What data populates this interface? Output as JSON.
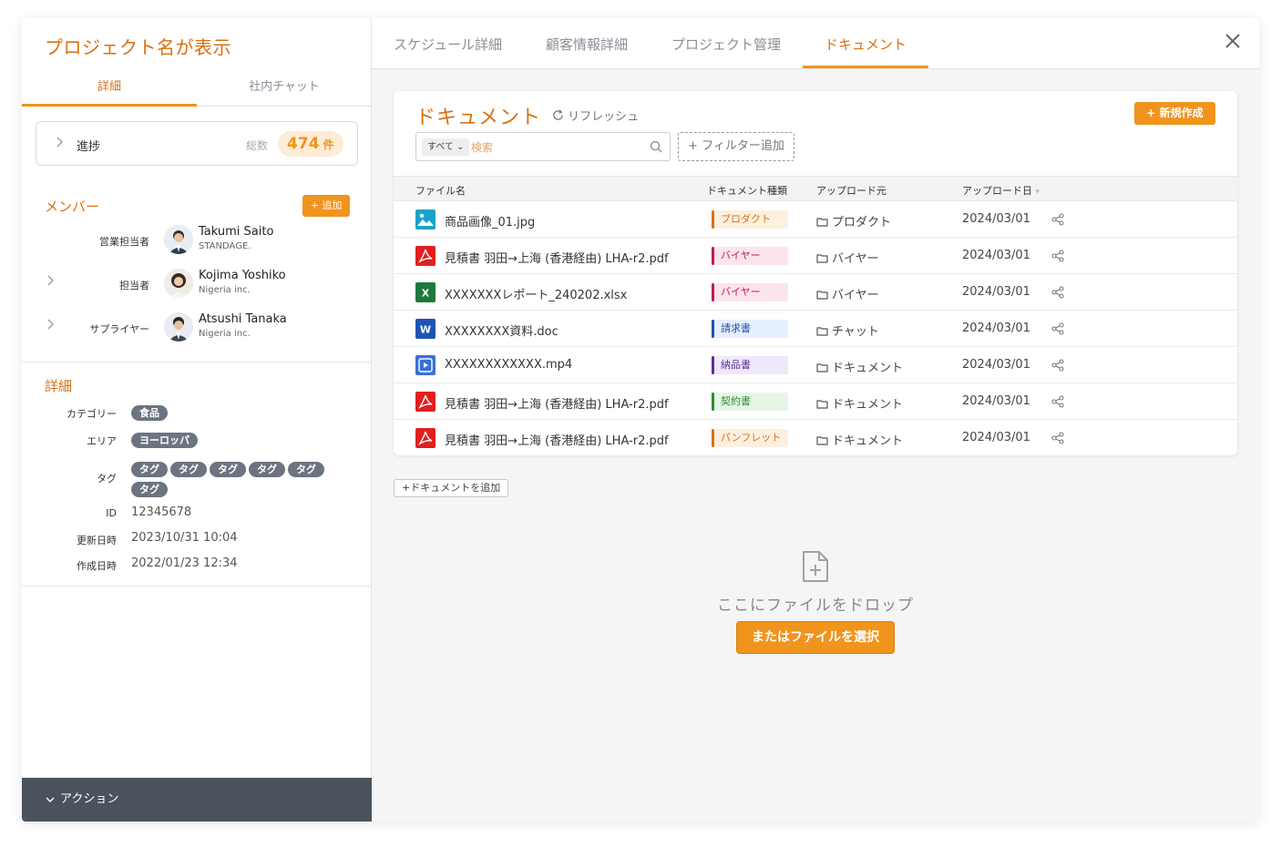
{
  "left": {
    "project_title": "プロジェクト名が表示",
    "tabs": [
      {
        "label": "詳細"
      },
      {
        "label": "社内チャット"
      }
    ],
    "progress": {
      "label": "進捗",
      "total_label": "総数",
      "count": "474",
      "unit": "件"
    },
    "members": {
      "title": "メンバー",
      "add_label": "+ 追加",
      "items": [
        {
          "role": "営業担当者",
          "name": "Takumi Saito",
          "org": "STANDAGE."
        },
        {
          "role": "担当者",
          "name": "Kojima Yoshiko",
          "org": "Nigeria inc."
        },
        {
          "role": "サプライヤー",
          "name": "Atsushi Tanaka",
          "org": "Nigeria inc."
        }
      ]
    },
    "details": {
      "title": "詳細",
      "category_label": "カテゴリー",
      "category": "食品",
      "area_label": "エリア",
      "area": "ヨーロッパ",
      "tag_label": "タグ",
      "tags": [
        "タグ",
        "タグ",
        "タグ",
        "タグ",
        "タグ",
        "タグ"
      ],
      "id_label": "ID",
      "id": "12345678",
      "updated_label": "更新日時",
      "updated": "2023/10/31 10:04",
      "created_label": "作成日時",
      "created": "2022/01/23 12:34"
    },
    "action_label": "アクション"
  },
  "right": {
    "tabs": [
      {
        "label": "スケジュール詳細"
      },
      {
        "label": "顧客情報詳細"
      },
      {
        "label": "プロジェクト管理"
      },
      {
        "label": "ドキュメント"
      }
    ],
    "active_tab": "ドキュメント",
    "card": {
      "title": "ドキュメント",
      "refresh_label": "リフレッシュ",
      "new_label": "+ 新規作成",
      "search_scope": "すべて",
      "search_placeholder": "検索",
      "filter_label": "+ フィルター追加",
      "columns": [
        "ファイル名",
        "ドキュメント種類",
        "アップロード元",
        "アップロード日"
      ],
      "rows": [
        {
          "icon": "image-file-icon",
          "name": "商品画像_01.jpg",
          "type": "プロダクト",
          "type_color": "#d9700f",
          "type_bg": "#fdf0e0",
          "bar": "#d9700f",
          "source": "プロダクト",
          "date": "2024/03/01"
        },
        {
          "icon": "pdf-file-icon",
          "name": "見積書 羽田→上海 (香港経由) LHA-r2.pdf",
          "type": "バイヤー",
          "type_color": "#c2185b",
          "type_bg": "#fce4ec",
          "bar": "#c2185b",
          "source": "バイヤー",
          "date": "2024/03/01"
        },
        {
          "icon": "excel-file-icon",
          "name": "XXXXXXXレポート_240202.xlsx",
          "type": "バイヤー",
          "type_color": "#c2185b",
          "type_bg": "#fce4ec",
          "bar": "#c2185b",
          "source": "バイヤー",
          "date": "2024/03/01"
        },
        {
          "icon": "word-file-icon",
          "name": "XXXXXXXX資料.doc",
          "type": "請求書",
          "type_color": "#1e4fa8",
          "type_bg": "#e6efff",
          "bar": "#1e4fa8",
          "source": "チャット",
          "date": "2024/03/01"
        },
        {
          "icon": "video-file-icon",
          "name": "XXXXXXXXXXXX.mp4",
          "type": "納品書",
          "type_color": "#5b2d99",
          "type_bg": "#efe8fb",
          "bar": "#5b2d99",
          "source": "ドキュメント",
          "date": "2024/03/01"
        },
        {
          "icon": "pdf-file-icon",
          "name": "見積書 羽田→上海 (香港経由) LHA-r2.pdf",
          "type": "契約書",
          "type_color": "#2e8b2e",
          "type_bg": "#e6f6e6",
          "bar": "#2e8b2e",
          "source": "ドキュメント",
          "date": "2024/03/01"
        },
        {
          "icon": "pdf-file-icon",
          "name": "見積書 羽田→上海 (香港経由) LHA-r2.pdf",
          "type": "パンフレット",
          "type_color": "#d9700f",
          "type_bg": "#fdf0e0",
          "bar": "#d9700f",
          "source": "ドキュメント",
          "date": "2024/03/01"
        }
      ]
    },
    "add_document_label": "+ドキュメントを追加",
    "drop_text": "ここにファイルをドロップ",
    "select_file_label": "またはファイルを選択"
  }
}
